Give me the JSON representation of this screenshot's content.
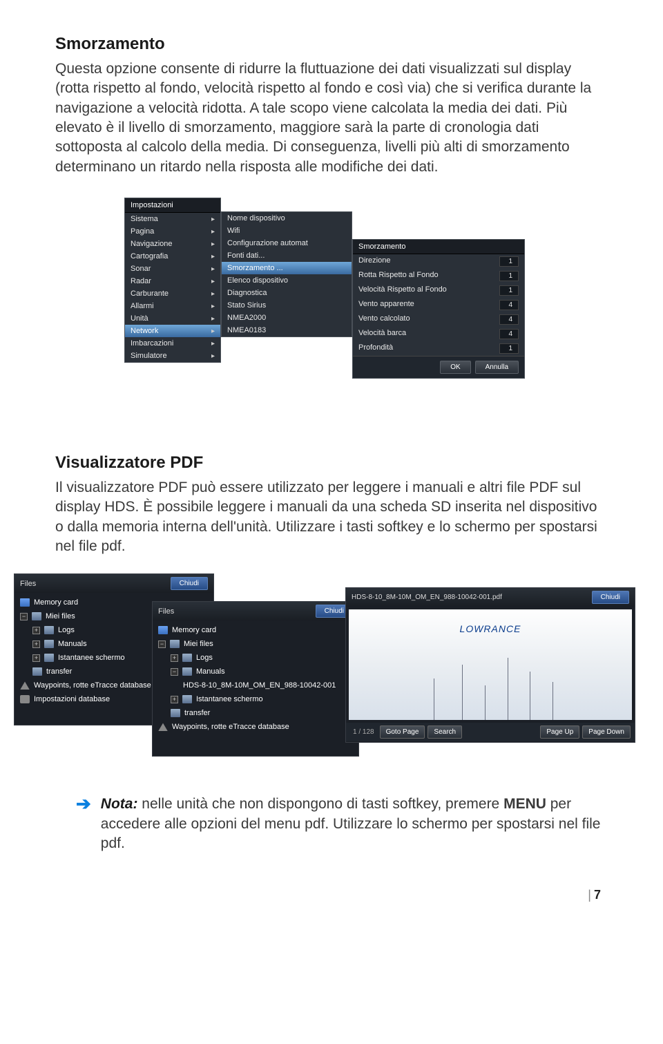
{
  "section1": {
    "title": "Smorzamento",
    "body": "Questa opzione consente di ridurre la fluttuazione dei dati visualizzati sul display (rotta rispetto al fondo, velocità rispetto al fondo e così via) che si verifica durante la navigazione a velocità ridotta. A tale scopo viene calcolata la media dei dati. Più elevato è il livello di smorzamento, maggiore sarà la parte di cronologia dati sottoposta al calcolo della media. Di conseguenza, livelli più alti di smorzamento determinano un ritardo nella risposta alle modifiche dei dati."
  },
  "settings_menu": {
    "header": "Impostazioni",
    "items": [
      "Sistema",
      "Pagina",
      "Navigazione",
      "Cartografia",
      "Sonar",
      "Radar",
      "Carburante",
      "Allarmi",
      "Unità",
      "Network",
      "Imbarcazioni",
      "Simulatore"
    ],
    "selected": "Network"
  },
  "network_submenu": {
    "items": [
      "Nome dispositivo",
      "Wifi",
      "Configurazione automat",
      "Fonti dati...",
      "Smorzamento ...",
      "Elenco dispositivo",
      "Diagnostica",
      "Stato Sirius",
      "NMEA2000",
      "NMEA0183"
    ],
    "selected": "Smorzamento ..."
  },
  "damping_dialog": {
    "header": "Smorzamento",
    "rows": [
      {
        "label": "Direzione",
        "value": "1"
      },
      {
        "label": "Rotta Rispetto al Fondo",
        "value": "1"
      },
      {
        "label": "Velocità Rispetto al Fondo",
        "value": "1"
      },
      {
        "label": "Vento apparente",
        "value": "4"
      },
      {
        "label": "Vento calcolato",
        "value": "4"
      },
      {
        "label": "Velocità barca",
        "value": "4"
      },
      {
        "label": "Profondità",
        "value": "1"
      }
    ],
    "ok": "OK",
    "cancel": "Annulla"
  },
  "section2": {
    "title": "Visualizzatore PDF",
    "body": "Il visualizzatore PDF può essere utilizzato per leggere i manuali e altri file PDF sul display HDS. È possibile leggere i manuali da una scheda SD inserita nel dispositivo o dalla memoria interna dell'unità. Utilizzare i tasti softkey e lo schermo per spostarsi nel file pdf."
  },
  "files1": {
    "header": "Files",
    "close": "Chiudi",
    "items": [
      "Memory card",
      "Miei files",
      "Logs",
      "Manuals",
      "Istantanee schermo",
      "transfer",
      "Waypoints, rotte eTracce database",
      "Impostazioni database"
    ]
  },
  "files2": {
    "header": "Files",
    "close": "Chiudi",
    "items": [
      "Memory card",
      "Miei files",
      "Logs",
      "Manuals",
      "HDS-8-10_8M-10M_OM_EN_988-10042-001",
      "Istantanee schermo",
      "transfer",
      "Waypoints, rotte eTracce database"
    ]
  },
  "pdf_viewer": {
    "title": "HDS-8-10_8M-10M_OM_EN_988-10042-001.pdf",
    "close": "Chiudi",
    "brand": "LOWRANCE",
    "page": "1 / 128",
    "goto": "Goto Page",
    "search": "Search",
    "pageup": "Page Up",
    "pagedown": "Page Down"
  },
  "nota": {
    "label": "Nota:",
    "text1": " nelle unità che non dispongono di tasti softkey, premere ",
    "menu": "MENU",
    "text2": " per accedere alle opzioni del menu pdf. Utilizzare lo schermo per spostarsi nel file pdf."
  },
  "page_number": "7"
}
